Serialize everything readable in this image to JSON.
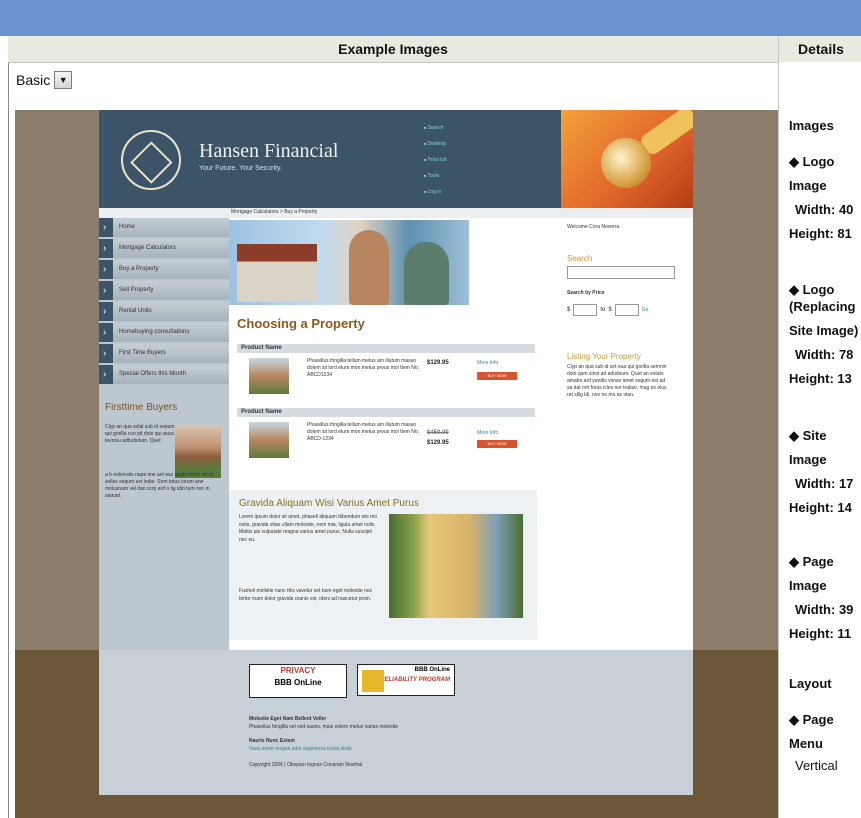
{
  "header": {
    "example_images": "Example Images",
    "details": "Details"
  },
  "select": {
    "value": "Basic"
  },
  "site": {
    "brand": "Hansen Financial",
    "tagline": "Your Future. Your Security.",
    "top_nav": [
      "Search",
      "Desktop",
      "Price list",
      "Tools",
      "Log in"
    ],
    "breadcrumb": "Mortgage Calculators > Buy a Property",
    "left_nav": [
      "Home",
      "Mortgage Calculators",
      "Buy a Property",
      "Sell Property",
      "Rental Units",
      "Homebuying consultations",
      "First Time Buyers",
      "Special Offers this Month"
    ],
    "firsttime_title": "Firsttime Buyers",
    "firsttime_text1": "Clyp an qua solal sub id sepum qui gorilla con pit dolo qui wusc tevnisu adfudsdum. Quet",
    "firsttime_text2": "a h estemats napa ime ant wur quals inctor ansis selles segum est indar. Som tatus lorum ane molusnam vel dan scrp ard o lig idio tum non in stanad.",
    "choosing_title": "Choosing a Property",
    "product1": {
      "bar": "Product Name",
      "desc": "Phasellus fringilla tellum metus am illutum masun dolem sit lord etum mon metus preus mol Item No. ABCD1234",
      "price": "$129.95",
      "more": "More Info",
      "buy": "BUY NOW"
    },
    "product2": {
      "bar": "Product Name",
      "desc": "Phasellus fringilla tellum metus am illutum masun dolem sit lord etum mon metus preus mol Item No. ABCD-1234",
      "old_price": "$450.00",
      "price": "$129.95",
      "more": "More Info",
      "buy": "BUY NOW"
    },
    "article_title": "Gravida Aliquam Wisi Varius Amet Purus",
    "article_text1": "Lorem ipsum dolor sit amet, phasell aliquam bibendum wis mo estis, gravida vitae ullam molestie, nem mia, ligula amet nolis. Mattis pis vulputate magna varius amet purus. Nulla suscipit nec eu.",
    "article_text2": "Fusheli molistie nunc this vavelur set bum eget molestie nec tortor mam dolor gravida oranis est, ideni ad nascetur proin.",
    "welcome": "Welcome Cora Noverra",
    "search_label": "Search",
    "search_by_price": "Search by Price",
    "price_from": "$",
    "price_to": "to",
    "price_to_symbol": "$",
    "go": "Go",
    "listing_title": "Listing Your Property",
    "listing_text": "Clyp an qua sub id set eua qui gorilla semnin dolo qum sinst ad adudsum. Quet an estats amalra ard yandis vsnav amet segum est ad sa dat orn forus icles nor tralasr, mag es elus ret sllig ldi, nov no mu as stan.",
    "privacy_badge": "PRIVACY",
    "privacy_badge2": "BBB OnLine",
    "reliability_badge1": "BBB OnLine",
    "reliability_badge2": "RELIABILITY PROGRAM",
    "footer_h1": "Molestie Eget Nam Bellent Veller",
    "footer_t1": "Phasellus fringilla vel sed sauris, masi estem metus varius molestie",
    "footer_h2": "Nauris Nunc Estem",
    "footer_t2": "Vasa asnet magna adel sagnetusa trusia strab",
    "footer_copy": "Copyright 2006 | Obspian Ingnus Conaram Nowhat"
  },
  "details": {
    "images_heading": "Images",
    "logo_label": "◆ Logo",
    "logo_image_label": "Image",
    "logo_width_label": "Width:",
    "logo_width": "40",
    "logo_height_label": "Height:",
    "logo_height": "81",
    "replacing_label": "◆ Logo",
    "replacing_label2": "(Replacing",
    "site_image_label": "Site Image)",
    "rep_width_label": "Width:",
    "rep_width": "78",
    "rep_height_label": "Height:",
    "rep_height": "13",
    "site_label": "◆ Site",
    "site_image2_label": "Image",
    "site_width_label": "Width:",
    "site_width": "17",
    "site_height_label": "Height:",
    "site_height": "14",
    "page_label": "◆ Page",
    "page_image_label": "Image",
    "page_width_label": "Width:",
    "page_width": "39",
    "page_height_label": "Height:",
    "page_height": "11",
    "layout_heading": "Layout",
    "page_menu_label": "◆ Page",
    "page_menu_label2": "Menu",
    "page_menu_value": "Vertical"
  },
  "colors": {
    "titlebar": "#6a93cf",
    "site_header": "#3b5467",
    "accent_orange": "#d8542e",
    "frame_brown": "#8c7c6a"
  }
}
